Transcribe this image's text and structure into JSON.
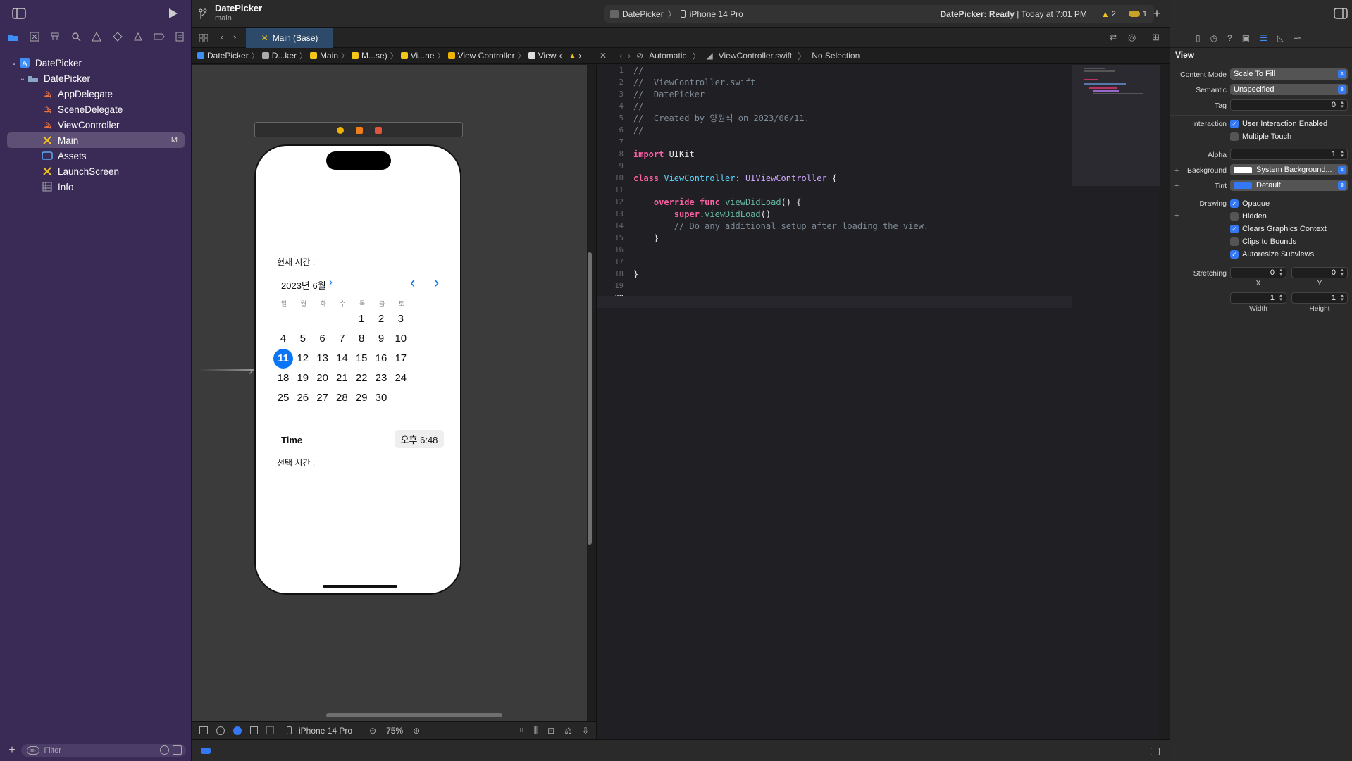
{
  "toolbar": {
    "project": "DatePicker",
    "branch": "main",
    "scheme": "DatePicker",
    "destination": "iPhone 14 Pro",
    "status": "DatePicker: Ready",
    "status_time": "Today at 7:01 PM",
    "warnings": "2",
    "issues": "1"
  },
  "tab": {
    "label": "Main (Base)"
  },
  "navigator": {
    "items": [
      {
        "label": "DatePicker",
        "level": 0,
        "icon": "project-icon",
        "expanded": true
      },
      {
        "label": "DatePicker",
        "level": 1,
        "icon": "folder-icon",
        "expanded": true
      },
      {
        "label": "AppDelegate",
        "level": 2,
        "icon": "swift-file-icon"
      },
      {
        "label": "SceneDelegate",
        "level": 2,
        "icon": "swift-file-icon"
      },
      {
        "label": "ViewController",
        "level": 2,
        "icon": "swift-file-icon"
      },
      {
        "label": "Main",
        "level": 2,
        "icon": "storyboard-icon",
        "selected": true,
        "badge": "M"
      },
      {
        "label": "Assets",
        "level": 2,
        "icon": "assets-icon"
      },
      {
        "label": "LaunchScreen",
        "level": 2,
        "icon": "storyboard-icon"
      },
      {
        "label": "Info",
        "level": 2,
        "icon": "plist-icon"
      }
    ],
    "filter_placeholder": "Filter"
  },
  "jumpbar_left": [
    "DatePicker",
    "D...ker",
    "Main",
    "M...se)",
    "Vi...ne",
    "View Controller",
    "View"
  ],
  "jumpbar_right": [
    "Automatic",
    "ViewController.swift",
    "No Selection"
  ],
  "canvas": {
    "device": "iPhone 14 Pro",
    "zoom": "75%"
  },
  "phone": {
    "label_now": "현재 시간 :",
    "month": "2023년 6월",
    "weekdays": [
      "일",
      "월",
      "화",
      "수",
      "목",
      "금",
      "토"
    ],
    "days": [
      "1",
      "2",
      "3",
      "4",
      "5",
      "6",
      "7",
      "8",
      "9",
      "10",
      "11",
      "12",
      "13",
      "14",
      "15",
      "16",
      "17",
      "18",
      "19",
      "20",
      "21",
      "22",
      "23",
      "24",
      "25",
      "26",
      "27",
      "28",
      "29",
      "30"
    ],
    "first_weekday_index": 4,
    "selected_day": "11",
    "time_label": "Time",
    "time_value": "오후 6:48",
    "label_selected": "선택 시간 :"
  },
  "code": {
    "lines": [
      "//",
      "//  ViewController.swift",
      "//  DatePicker",
      "//",
      "//  Created by 양원식 on 2023/06/11.",
      "//",
      "",
      "import UIKit",
      "",
      "class ViewController: UIViewController {",
      "",
      "    override func viewDidLoad() {",
      "        super.viewDidLoad()",
      "        // Do any additional setup after loading the view.",
      "    }",
      "",
      "",
      "}",
      "",
      ""
    ],
    "current_line": 20
  },
  "inspector": {
    "section": "View",
    "content_mode_label": "Content Mode",
    "content_mode": "Scale To Fill",
    "semantic_label": "Semantic",
    "semantic": "Unspecified",
    "tag_label": "Tag",
    "tag": "0",
    "interaction_label": "Interaction",
    "user_interaction": "User Interaction Enabled",
    "multiple_touch": "Multiple Touch",
    "alpha_label": "Alpha",
    "alpha": "1",
    "background_label": "Background",
    "background": "System Background...",
    "tint_label": "Tint",
    "tint": "Default",
    "drawing_label": "Drawing",
    "opaque": "Opaque",
    "hidden": "Hidden",
    "clears_graphics": "Clears Graphics Context",
    "clips_to_bounds": "Clips to Bounds",
    "autoresize": "Autoresize Subviews",
    "stretching_label": "Stretching",
    "stretch_x": "0",
    "stretch_y": "0",
    "stretch_w": "1",
    "stretch_h": "1",
    "x_label": "X",
    "y_label": "Y",
    "width_label": "Width",
    "height_label": "Height"
  },
  "colors": {
    "accent": "#0a76f6",
    "sidebar": "#3a2a56",
    "swift": "#f0743e",
    "storyboard": "#f5c518"
  }
}
